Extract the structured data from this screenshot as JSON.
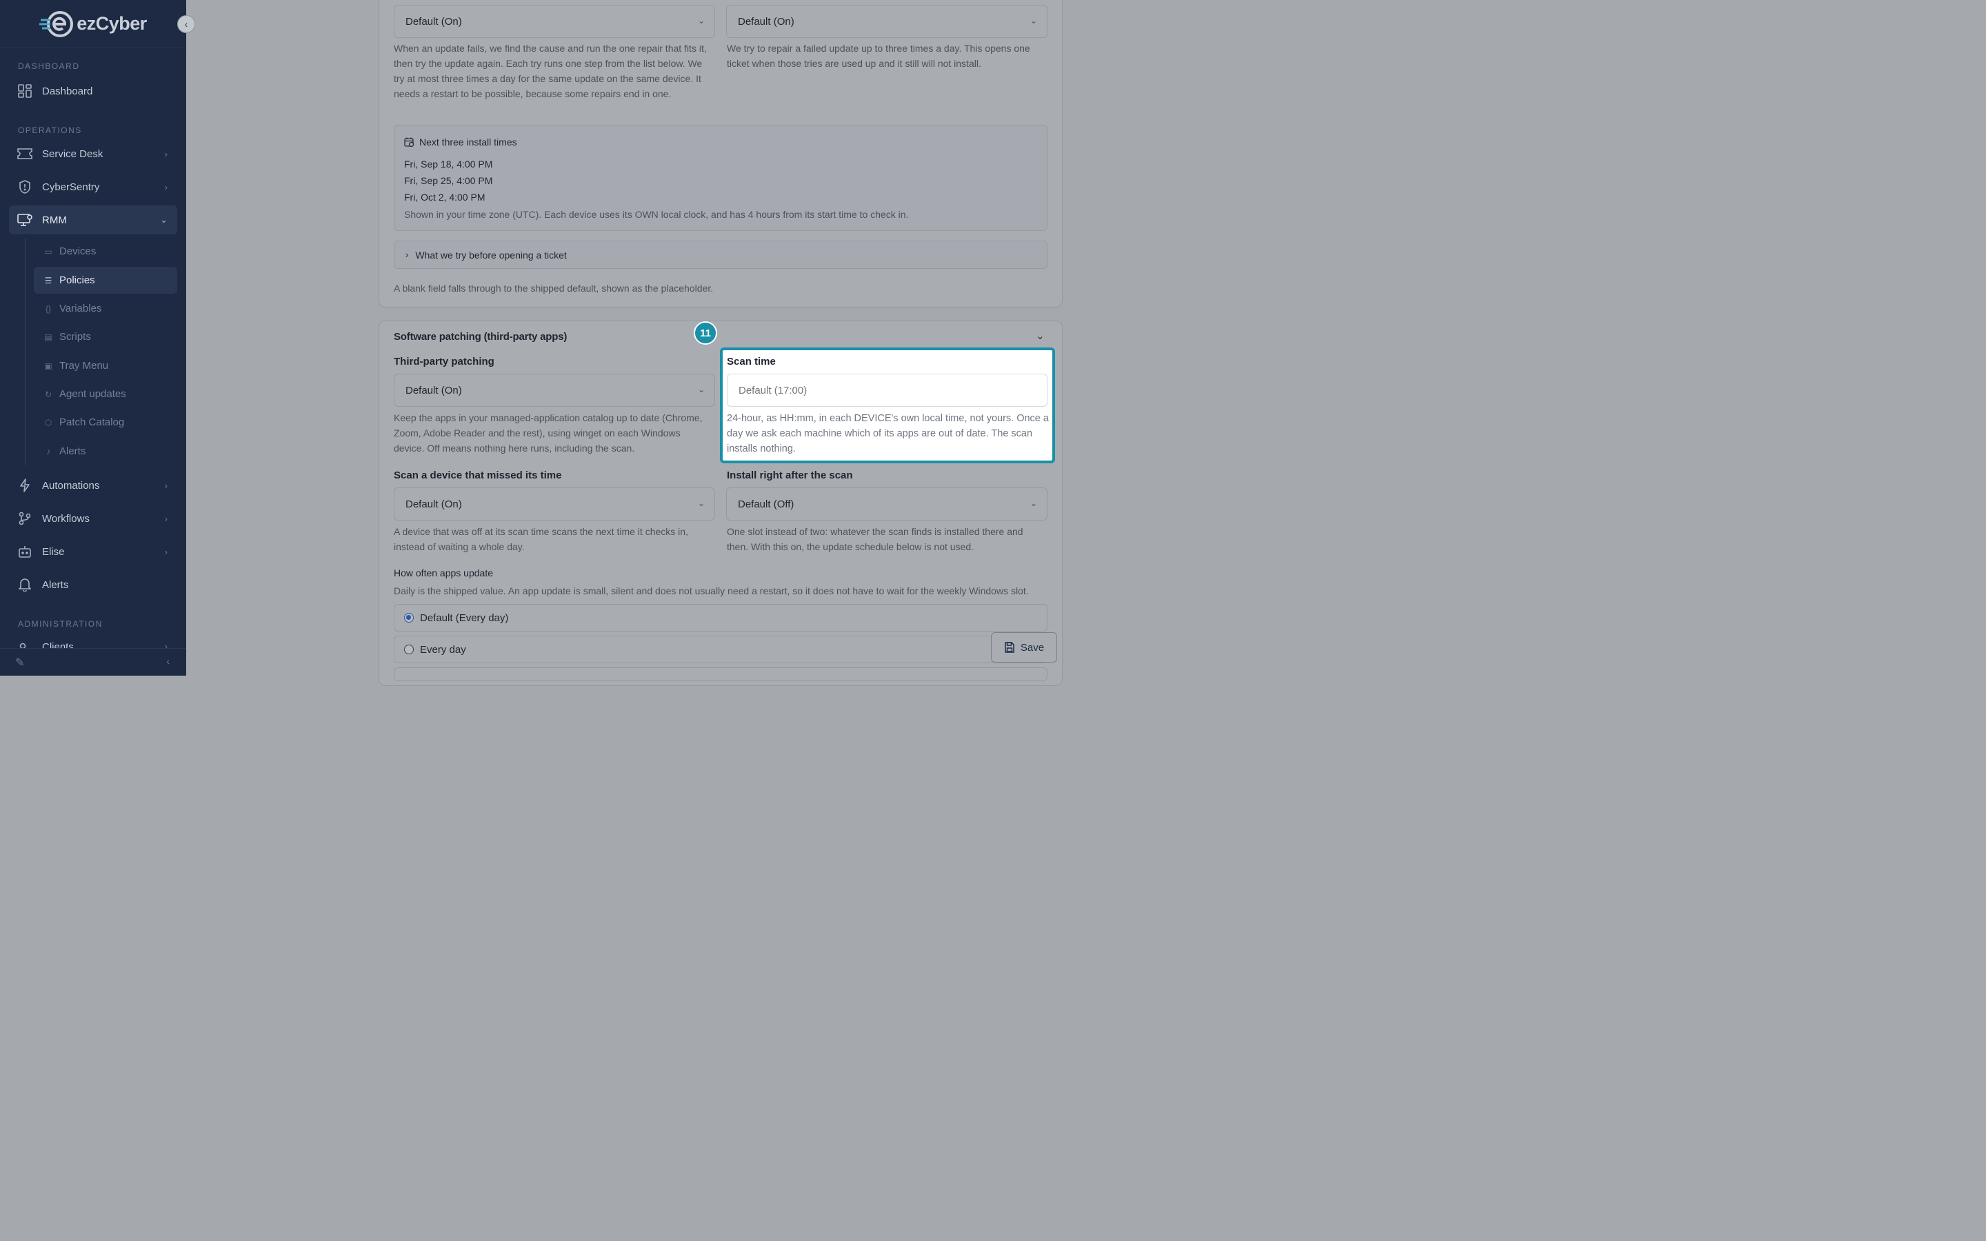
{
  "brand": {
    "name": "ezCyber"
  },
  "sidebar": {
    "sections": {
      "dashboard": "DASHBOARD",
      "operations": "OPERATIONS",
      "administration": "ADMINISTRATION"
    },
    "items": {
      "dashboard": "Dashboard",
      "service_desk": "Service Desk",
      "cybersentry": "CyberSentry",
      "rmm": "RMM",
      "automations": "Automations",
      "workflows": "Workflows",
      "elise": "Elise",
      "alerts": "Alerts",
      "clients": "Clients"
    },
    "rmm_sub": {
      "devices": "Devices",
      "policies": "Policies",
      "variables": "Variables",
      "scripts": "Scripts",
      "tray_menu": "Tray Menu",
      "agent_updates": "Agent updates",
      "patch_catalog": "Patch Catalog",
      "alerts": "Alerts"
    }
  },
  "windows_section": {
    "select_left": "Default (On)",
    "select_right": "Default (On)",
    "help_left": "When an update fails, we find the cause and run the one repair that fits it, then try the update again. Each try runs one step from the list below. We try at most three times a day for the same update on the same device. It needs a restart to be possible, because some repairs end in one.",
    "help_right": "We try to repair a failed update up to three times a day. This opens one ticket when those tries are used up and it still will not install.",
    "install_times": {
      "title": "Next three install times",
      "times": [
        "Fri, Sep 18, 4:00 PM",
        "Fri, Sep 25, 4:00 PM",
        "Fri, Oct 2, 4:00 PM"
      ],
      "note": "Shown in your time zone (UTC). Each device uses its OWN local clock, and has 4 hours from its start time to check in."
    },
    "expander": "What we try before opening a ticket",
    "blank_note": "A blank field falls through to the shipped default, shown as the placeholder."
  },
  "software_section": {
    "title": "Software patching (third-party apps)",
    "badge": "11",
    "third_party": {
      "label": "Third-party patching",
      "value": "Default (On)",
      "help": "Keep the apps in your managed-application catalog up to date (Chrome, Zoom, Adobe Reader and the rest), using winget on each Windows device. Off means nothing here runs, including the scan."
    },
    "scan_time": {
      "label": "Scan time",
      "placeholder": "Default (17:00)",
      "help": "24-hour, as HH:mm, in each DEVICE's own local time, not yours. Once a day we ask each machine which of its apps are out of date. The scan installs nothing."
    },
    "missed": {
      "label": "Scan a device that missed its time",
      "value": "Default (On)",
      "help": "A device that was off at its scan time scans the next time it checks in, instead of waiting a whole day."
    },
    "install_after": {
      "label": "Install right after the scan",
      "value": "Default (Off)",
      "help": "One slot instead of two: whatever the scan finds is installed there and then. With this on, the update schedule below is not used."
    },
    "frequency": {
      "label": "How often apps update",
      "help": "Daily is the shipped value. An app update is small, silent and does not usually need a restart, so it does not have to wait for the weekly Windows slot.",
      "options": [
        "Default (Every day)",
        "Every day"
      ]
    }
  },
  "save_label": "Save"
}
